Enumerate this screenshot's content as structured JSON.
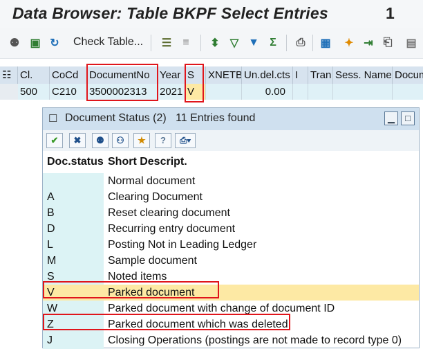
{
  "window": {
    "title": "Data Browser: Table BKPF Select Entries",
    "count": "1"
  },
  "toolbar": {
    "check_table_label": "Check Table..."
  },
  "grid": {
    "headers": [
      "Cl.",
      "CoCd",
      "DocumentNo",
      "Year",
      "S",
      "XNETB",
      "Un.del.cts",
      "I",
      "Tran",
      "Sess. Name",
      "Docum"
    ],
    "row": [
      "500",
      "C210",
      "3500002313",
      "2021",
      "V",
      "",
      "0.00",
      "",
      "",
      "",
      ""
    ]
  },
  "dialog": {
    "title": "Document Status (2)",
    "found": "11 Entries found",
    "col_status": "Doc.status",
    "col_desc": "Short Descript.",
    "rows": [
      {
        "code": "",
        "desc": "Normal document"
      },
      {
        "code": "A",
        "desc": "Clearing Document"
      },
      {
        "code": "B",
        "desc": "Reset clearing document"
      },
      {
        "code": "D",
        "desc": "Recurring entry document"
      },
      {
        "code": "L",
        "desc": "Posting Not in Leading Ledger"
      },
      {
        "code": "M",
        "desc": "Sample document"
      },
      {
        "code": "S",
        "desc": "Noted items"
      },
      {
        "code": "V",
        "desc": "Parked document"
      },
      {
        "code": "W",
        "desc": "Parked document with change of document ID"
      },
      {
        "code": "Z",
        "desc": "Parked document which was deleted"
      },
      {
        "code": "J",
        "desc": "Closing Operations (postings are not made to record type 0)"
      }
    ]
  },
  "colors": {
    "highlight": "#e0151b",
    "selected_row": "#fde9a4",
    "status_column": "#dcf3f5",
    "header": "#d7e3ef"
  }
}
